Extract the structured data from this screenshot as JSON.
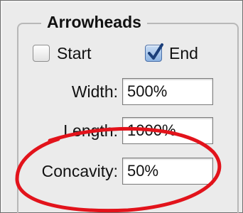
{
  "arrowheads": {
    "title": "Arrowheads",
    "start": {
      "label": "Start",
      "checked": false
    },
    "end": {
      "label": "End",
      "checked": true
    },
    "fields": {
      "width": {
        "label": "Width:",
        "value": "500%"
      },
      "length": {
        "label": "Length:",
        "value": "1000%"
      },
      "concavity": {
        "label": "Concavity:",
        "value": "50%"
      }
    }
  },
  "colors": {
    "panel_background": "#ebebeb",
    "annotation": "#e2131b",
    "check_accent": "#2f5ea8"
  }
}
